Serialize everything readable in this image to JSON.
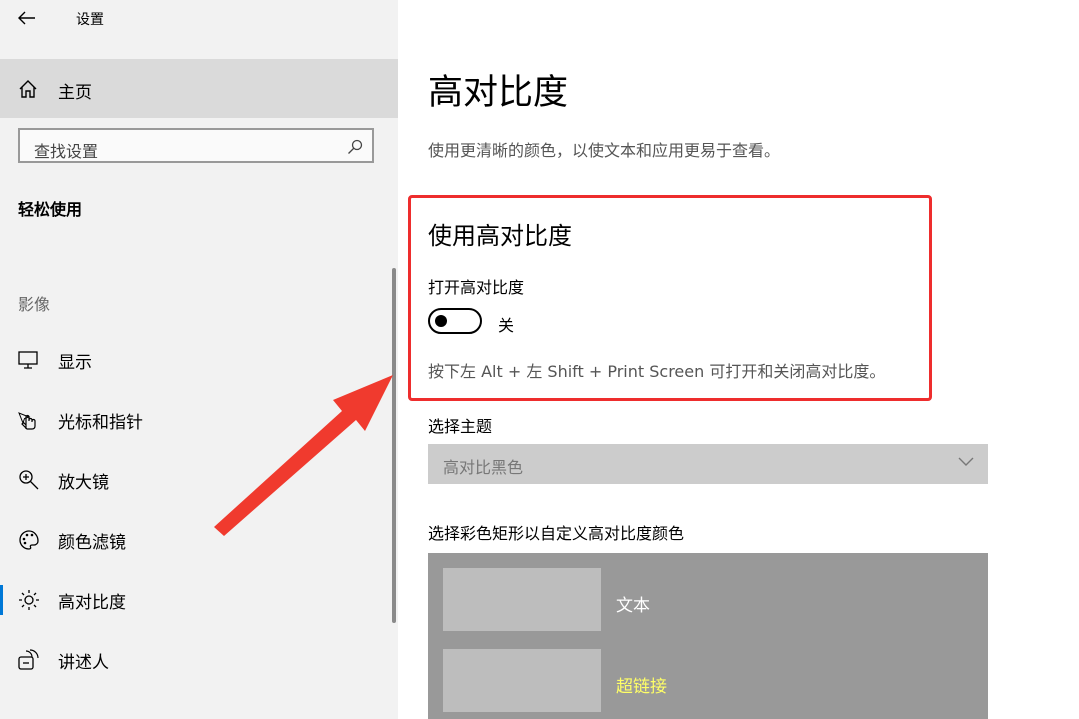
{
  "app": {
    "title": "设置"
  },
  "sidebar": {
    "home_label": "主页",
    "search_placeholder": "查找设置",
    "section_title": "轻松使用",
    "group_label": "影像",
    "items": [
      {
        "label": "显示",
        "icon": "monitor-icon"
      },
      {
        "label": "光标和指针",
        "icon": "cursor-hand-icon"
      },
      {
        "label": "放大镜",
        "icon": "magnifier-icon"
      },
      {
        "label": "颜色滤镜",
        "icon": "palette-icon"
      },
      {
        "label": "高对比度",
        "icon": "sun-icon",
        "selected": true
      },
      {
        "label": "讲述人",
        "icon": "narrator-icon"
      }
    ]
  },
  "main": {
    "title": "高对比度",
    "description": "使用更清晰的颜色，以使文本和应用更易于查看。",
    "subsection_title": "使用高对比度",
    "toggle_label": "打开高对比度",
    "toggle_state": "关",
    "hint": "按下左 Alt + 左 Shift + Print Screen 可打开和关闭高对比度。",
    "theme_label": "选择主题",
    "theme_value": "高对比黑色",
    "custom_label": "选择彩色矩形以自定义高对比度颜色",
    "color_items": [
      {
        "label": "文本",
        "color": "#ffffff"
      },
      {
        "label": "超链接",
        "color": "#ffff66"
      }
    ]
  },
  "colors": {
    "accent": "#0078d7",
    "highlight_border": "#ee2d2d",
    "arrow": "#f03a2e"
  }
}
